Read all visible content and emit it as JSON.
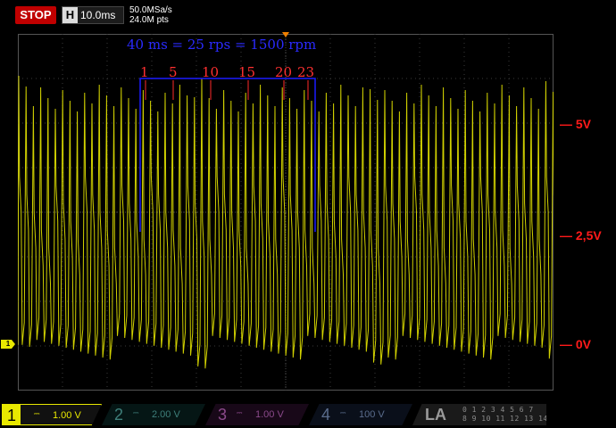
{
  "header": {
    "run_state": "STOP",
    "timebase_letter": "H",
    "timebase": "10.0ms",
    "sample_rate": "50.0MSa/s",
    "memory_depth": "24.0M pts"
  },
  "screen": {
    "channel_marker": "1",
    "annotation": "40 ms = 25 rps = 1500 rpm",
    "revolution_marks": [
      "1",
      "5",
      "10",
      "15",
      "20",
      "23"
    ],
    "voltage_labels": [
      "5V",
      "2,5V",
      "0V"
    ],
    "colors": {
      "trace": "#e8e800",
      "annotation_box": "#1a1aff",
      "marks": "#ff2a2a",
      "grid": "#3a3a3a"
    }
  },
  "bottom": {
    "ch1": {
      "num": "1",
      "scale": "1.00 V"
    },
    "ch2": {
      "num": "2",
      "scale": "2.00 V"
    },
    "ch3": {
      "num": "3",
      "scale": "1.00 V"
    },
    "ch4": {
      "num": "4",
      "scale": "100 V"
    },
    "la": {
      "label": "LA",
      "rows": [
        "0 1 2 3   4 5 6 7",
        "8 9 10 11 12 13 14 15"
      ]
    }
  }
}
